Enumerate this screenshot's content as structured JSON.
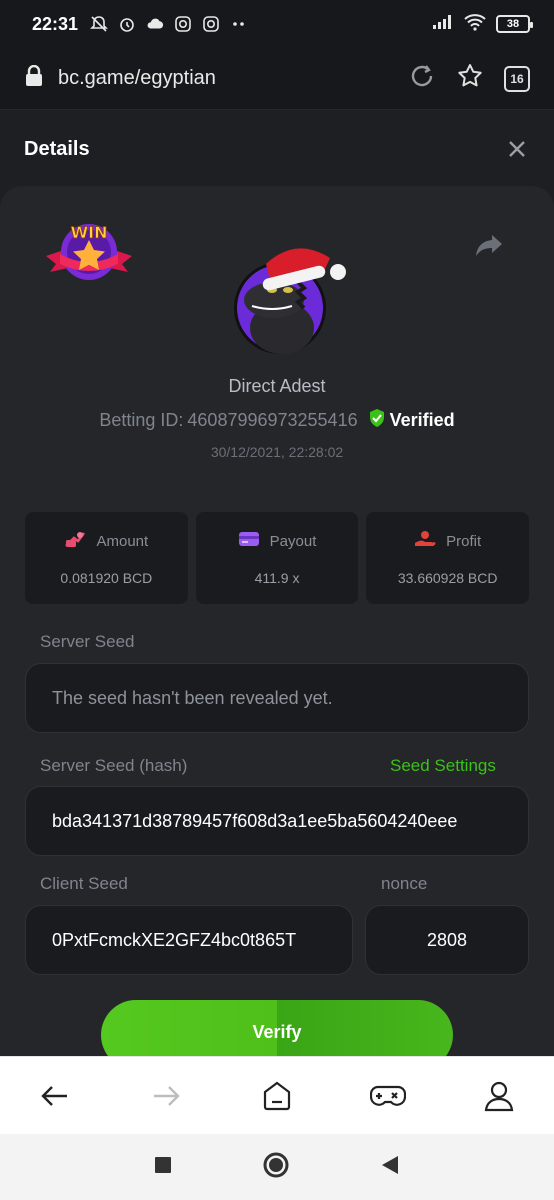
{
  "status_bar": {
    "time": "22:31",
    "battery": "38",
    "icons": [
      "muted-bell-icon",
      "alarm-icon",
      "cloud-icon",
      "instagram-icon",
      "instagram-icon",
      "more-dots-icon",
      "signal-icon",
      "wifi-icon",
      "battery-icon"
    ]
  },
  "browser": {
    "url": "bc.game/egyptian",
    "tab_count": "16"
  },
  "details": {
    "title": "Details",
    "user_name": "Direct Adest",
    "betting_id_label": "Betting ID:",
    "betting_id": "46087996973255416",
    "verified_label": "Verified",
    "timestamp": "30/12/2021, 22:28:02",
    "badge_text": "WIN"
  },
  "stats": [
    {
      "label": "Amount",
      "value": "0.081920 BCD",
      "icon": "amount-icon",
      "color": "#e54e6f"
    },
    {
      "label": "Payout",
      "value": "411.9 x",
      "icon": "payout-card-icon",
      "color": "#9a5cf2"
    },
    {
      "label": "Profit",
      "value": "33.660928 BCD",
      "icon": "profit-hand-icon",
      "color": "#e0423c"
    }
  ],
  "fields": {
    "server_seed_label": "Server Seed",
    "server_seed_value": "The seed hasn't been revealed yet.",
    "server_seed_hash_label": "Server Seed (hash)",
    "seed_settings_link": "Seed Settings",
    "server_seed_hash_value": "bda341371d38789457f608d3a1ee5ba5604240eee",
    "client_seed_label": "Client Seed",
    "client_seed_value": "0PxtFcmckXE2GFZ4bc0t865T",
    "nonce_label": "nonce",
    "nonce_value": "2808"
  },
  "verify_button": "Verify",
  "colors": {
    "accent_green": "#3bc117",
    "page_bg": "#24262a",
    "card_bg": "#1a1b1e"
  }
}
